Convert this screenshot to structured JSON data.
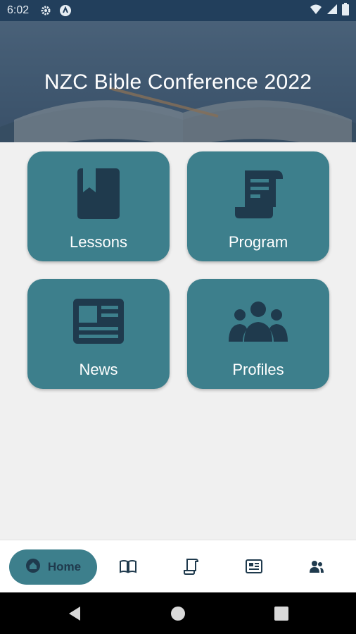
{
  "status_bar": {
    "time": "6:02",
    "icons": [
      "settings-icon",
      "app-badge-icon",
      "wifi-icon",
      "signal-icon",
      "battery-icon"
    ]
  },
  "header": {
    "title": "NZC Bible Conference 2022"
  },
  "tiles": [
    {
      "label": "Lessons",
      "icon": "bookmark-book-icon"
    },
    {
      "label": "Program",
      "icon": "scroll-icon"
    },
    {
      "label": "News",
      "icon": "newspaper-icon"
    },
    {
      "label": "Profiles",
      "icon": "group-icon"
    }
  ],
  "bottom_nav": {
    "home_label": "Home",
    "items": [
      "home-icon",
      "book-icon",
      "scroll-icon",
      "newspaper-icon",
      "people-icon"
    ]
  },
  "system_nav": {
    "buttons": [
      "back-icon",
      "home-circle-icon",
      "recents-icon"
    ]
  },
  "colors": {
    "status_bar": "#223f5c",
    "tile": "#3d7f8c",
    "icon_dark": "#1f3a4d",
    "background": "#f0f0f0"
  }
}
